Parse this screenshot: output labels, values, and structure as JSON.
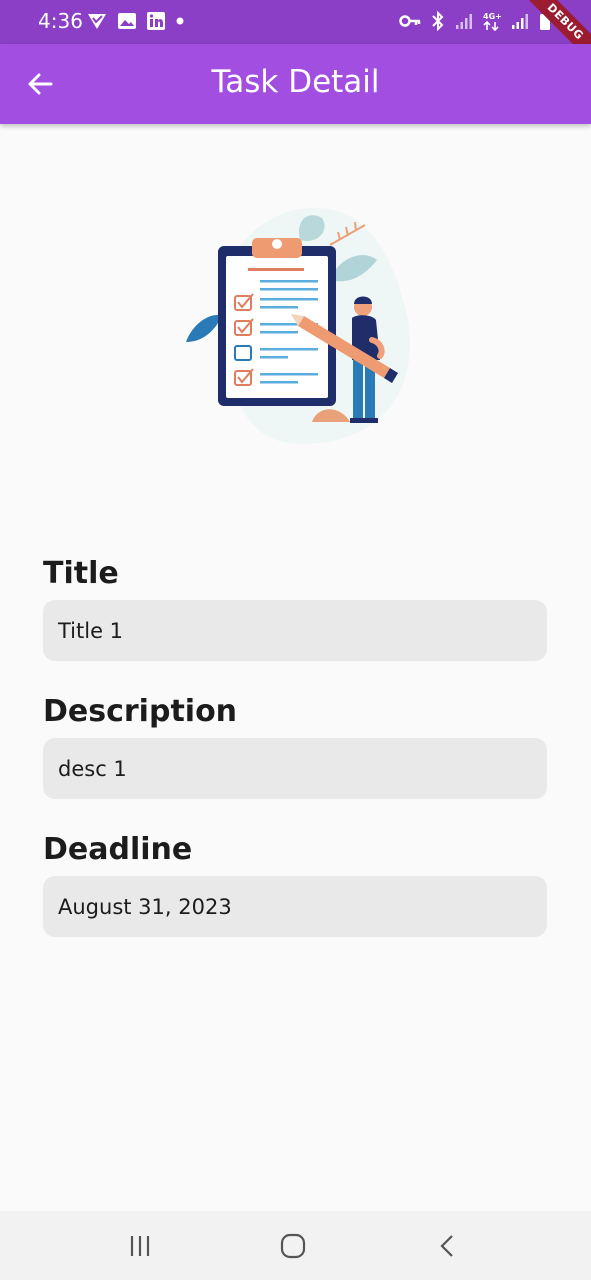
{
  "status_bar": {
    "time": "4:36",
    "debug_label": "DEBUG",
    "left_icons": [
      "vpn-check-icon",
      "image-icon",
      "linkedin-icon",
      "notification-dot-icon"
    ],
    "right_icons": [
      "key-icon",
      "bluetooth-icon",
      "signal-icon",
      "4g-signal-icon",
      "signal-icon",
      "battery-icon"
    ]
  },
  "app_bar": {
    "title": "Task Detail",
    "back_icon": "arrow-left-icon"
  },
  "illustration": {
    "icon": "clipboard-checklist-illustration"
  },
  "fields": {
    "title": {
      "label": "Title",
      "value": "Title 1"
    },
    "description": {
      "label": "Description",
      "value": "desc 1"
    },
    "deadline": {
      "label": "Deadline",
      "value": "August 31, 2023"
    }
  },
  "nav_bar": {
    "icons": [
      "recent-apps-icon",
      "home-icon",
      "back-icon"
    ]
  },
  "colors": {
    "status_bar": "#8a3fc6",
    "app_bar": "#a24ee0",
    "field_bg": "#e9e9e9",
    "background": "#fafafa"
  }
}
